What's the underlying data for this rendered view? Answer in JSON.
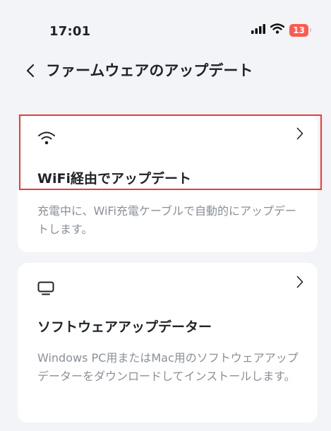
{
  "status_bar": {
    "time": "17:01",
    "battery_level": "13",
    "icons": [
      "signal-icon",
      "wifi-icon",
      "battery-icon"
    ]
  },
  "nav": {
    "back_icon": "chevron-left-icon",
    "title": "ファームウェアのアップデート"
  },
  "options": [
    {
      "icon": "wifi-icon",
      "title": "WiFi経由でアップデート",
      "description": "充電中に、WiFi充電ケーブルで自動的にアップデートします。",
      "chevron_icon": "chevron-right-icon",
      "highlighted": true
    },
    {
      "icon": "monitor-icon",
      "title": "ソフトウェアアップデーター",
      "description": "Windows PC用またはMac用のソフトウェアアップデーターをダウンロードしてインストールします。",
      "chevron_icon": "chevron-right-icon",
      "highlighted": false
    }
  ],
  "colors": {
    "background": "#f3f4f7",
    "card": "#ffffff",
    "highlight_border": "#e53e3a",
    "battery_low": "#ff5a4f",
    "description_text": "#8a8f98"
  }
}
